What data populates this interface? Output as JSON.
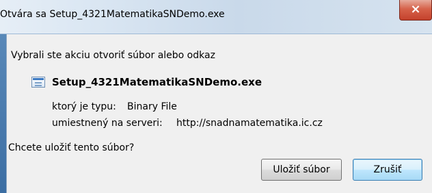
{
  "window": {
    "title": "Otvára sa Setup_4321MatematikaSNDemo.exe",
    "close_icon": "×"
  },
  "dialog": {
    "intro": "Vybrali ste akciu otvoriť súbor alebo odkaz",
    "file_icon": "exe-file-icon",
    "filename": "Setup_4321MatematikaSNDemo.exe",
    "type_label": "ktorý je typu:",
    "type_value": "Binary File",
    "server_label": "umiestnený na serveri:",
    "server_value": "http://snadnamatematika.ic.cz",
    "question": "Chcete uložiť tento súbor?",
    "buttons": {
      "save": "Uložiť súbor",
      "cancel": "Zrušiť"
    }
  }
}
